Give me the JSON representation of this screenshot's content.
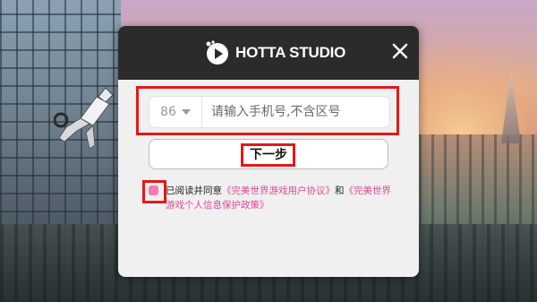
{
  "header": {
    "brand": "HOTTA STUDIO",
    "close_icon": "close-icon"
  },
  "login_form": {
    "country_code": "86",
    "phone_placeholder": "请输入手机号,不含区号",
    "next_button_label": "下一步"
  },
  "agreement": {
    "checked": true,
    "prefix": "已阅读并同意",
    "user_agreement_link": "《完美世界游戏用户协议》",
    "connector": "和",
    "privacy_policy_link": "《完美世界游戏个人信息保护政策》",
    "link_color": "#e0489a",
    "checkbox_color": "#f47bb0"
  },
  "annotation_color": "#e01a1a"
}
